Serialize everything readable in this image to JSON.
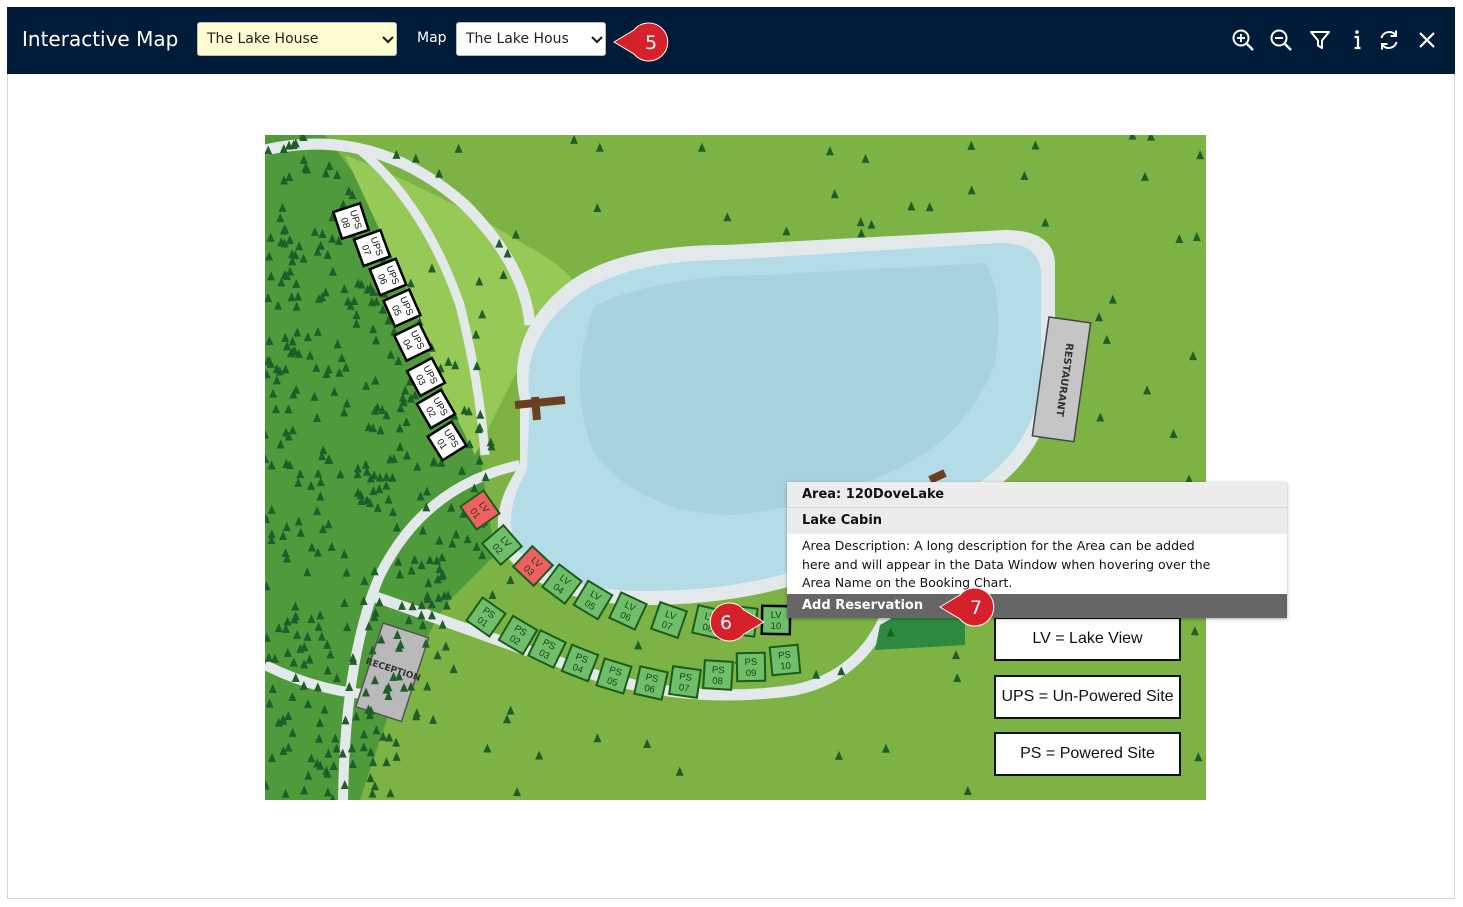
{
  "header": {
    "title": "Interactive Map",
    "property_select": {
      "value": "The Lake House"
    },
    "map_label": "Map",
    "map_select": {
      "value": "The Lake Hous"
    },
    "toolbar": {
      "icons": [
        "zoom-in-icon",
        "zoom-out-icon",
        "filter-icon",
        "info-icon",
        "refresh-icon",
        "close-icon"
      ]
    }
  },
  "callouts": {
    "five": "5",
    "six": "6",
    "seven": "7",
    "color": "#d6202a"
  },
  "map": {
    "ups_sites": [
      "UPS 08",
      "UPS 07",
      "UPS 06",
      "UPS 05",
      "UPS 04",
      "UPS 03",
      "UPS 02",
      "UPS 01"
    ],
    "lv_sites": [
      "LV 01",
      "LV 02",
      "LV 03",
      "LV 04",
      "LV 05",
      "LV 06",
      "LV 07",
      "LV 08",
      "LV 09",
      "LV 10"
    ],
    "ps_sites": [
      "PS 01",
      "PS 02",
      "PS 03",
      "PS 04",
      "PS 05",
      "PS 06",
      "PS 07",
      "PS 08",
      "PS 09",
      "PS 10"
    ],
    "booked_sites": [
      "LV 01",
      "LV 03"
    ],
    "selected_site": "LV 10",
    "restaurant_label": "RESTAURANT",
    "reception_label": "RECEPTION",
    "legend": {
      "lv": "LV = Lake View",
      "ups": "UPS = Un-Powered Site",
      "ps": "PS = Powered Site"
    },
    "colors": {
      "grass": "#7db344",
      "forest": "#4f9a3a",
      "lake": "#b3dce6",
      "path": "#e3e8ea",
      "site_green": "#6fbf6a",
      "site_booked": "#f06060"
    }
  },
  "popup": {
    "area": "Area: 120DoveLake",
    "type": "Lake Cabin",
    "description": "Area Description: A long description for the Area can be added here and will appear in the Data Window when hovering over the Area Name on the Booking Chart.",
    "action": "Add Reservation"
  }
}
